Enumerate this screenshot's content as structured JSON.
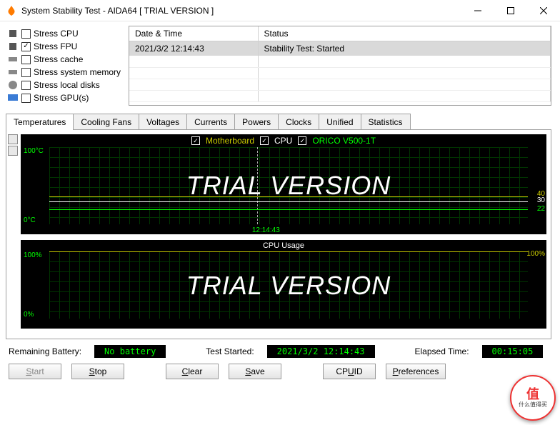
{
  "window": {
    "title": "System Stability Test - AIDA64  [ TRIAL VERSION ]"
  },
  "stress": {
    "items": [
      {
        "label": "Stress CPU",
        "checked": false
      },
      {
        "label": "Stress FPU",
        "checked": true
      },
      {
        "label": "Stress cache",
        "checked": false
      },
      {
        "label": "Stress system memory",
        "checked": false
      },
      {
        "label": "Stress local disks",
        "checked": false
      },
      {
        "label": "Stress GPU(s)",
        "checked": false
      }
    ]
  },
  "log": {
    "headers": [
      "Date & Time",
      "Status"
    ],
    "rows": [
      {
        "datetime": "2021/3/2 12:14:43",
        "status": "Stability Test: Started"
      }
    ]
  },
  "tabs": [
    "Temperatures",
    "Cooling Fans",
    "Voltages",
    "Currents",
    "Powers",
    "Clocks",
    "Unified",
    "Statistics"
  ],
  "activeTab": 0,
  "graph1": {
    "legend": [
      {
        "label": "Motherboard",
        "color": "#cccc00"
      },
      {
        "label": "CPU",
        "color": "#ffffff"
      },
      {
        "label": "ORICO V500-1T",
        "color": "#00ff00"
      }
    ],
    "ylabels": {
      "top": "100°C",
      "bottom": "0°C"
    },
    "rlabels": [
      {
        "text": "40",
        "color": "#cccc00",
        "topPct": 56
      },
      {
        "text": "30",
        "color": "#ffffff",
        "topPct": 62
      },
      {
        "text": "22",
        "color": "#00ff00",
        "topPct": 71
      }
    ],
    "xmarker": "12:14:43",
    "watermark": "TRIAL VERSION"
  },
  "graph2": {
    "title": "CPU Usage",
    "ylabels": {
      "top": "100%",
      "bottom": "0%"
    },
    "rlabel": {
      "text": "100%",
      "color": "#cccc00"
    },
    "watermark": "TRIAL VERSION"
  },
  "status": {
    "batteryLabel": "Remaining Battery:",
    "batteryValue": "No battery",
    "startedLabel": "Test Started:",
    "startedValue": "2021/3/2 12:14:43",
    "elapsedLabel": "Elapsed Time:",
    "elapsedValue": "00:15:05"
  },
  "buttons": {
    "start": "Start",
    "stop": "Stop",
    "clear": "Clear",
    "save": "Save",
    "cpuid": "CPUID",
    "prefs": "Preferences"
  },
  "badge": {
    "line1": "值",
    "line2": "什么值得买"
  },
  "chart_data": [
    {
      "type": "line",
      "title": "Temperatures",
      "ylabel": "°C",
      "ylim": [
        0,
        100
      ],
      "series": [
        {
          "name": "Motherboard",
          "values": [
            40
          ]
        },
        {
          "name": "CPU",
          "values": [
            30
          ]
        },
        {
          "name": "ORICO V500-1T",
          "values": [
            22
          ]
        }
      ],
      "x_marker": "12:14:43"
    },
    {
      "type": "line",
      "title": "CPU Usage",
      "ylabel": "%",
      "ylim": [
        0,
        100
      ],
      "series": [
        {
          "name": "CPU Usage",
          "values": [
            100
          ]
        }
      ]
    }
  ]
}
